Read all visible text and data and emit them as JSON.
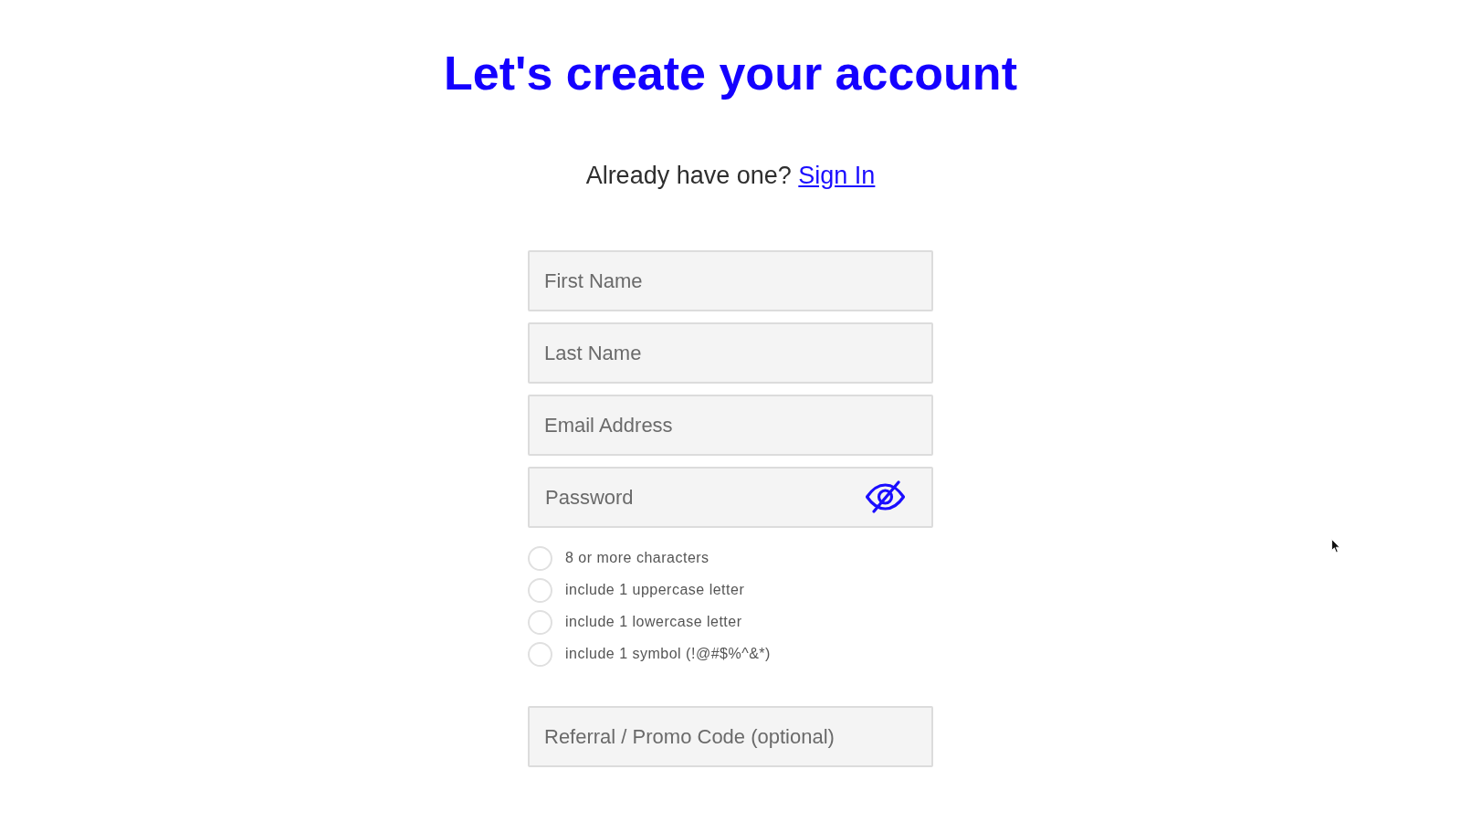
{
  "title": "Let's create your account",
  "signin_prompt": {
    "text": "Already have one?",
    "link": "Sign In"
  },
  "fields": [
    {
      "kind": "text",
      "placeholder": "First Name"
    },
    {
      "kind": "text",
      "placeholder": "Last Name"
    },
    {
      "kind": "text",
      "placeholder": "Email Address"
    },
    {
      "kind": "password",
      "placeholder": "Password"
    }
  ],
  "password_rules": [
    {
      "label": "8 or more characters",
      "checked": false
    },
    {
      "label": "include 1 uppercase letter",
      "checked": false
    },
    {
      "label": "include 1 lowercase letter",
      "checked": false
    },
    {
      "label": "include 1 symbol (!@#$%^&*)",
      "checked": false
    }
  ],
  "promo_field": {
    "placeholder": "Referral / Promo Code (optional)"
  }
}
